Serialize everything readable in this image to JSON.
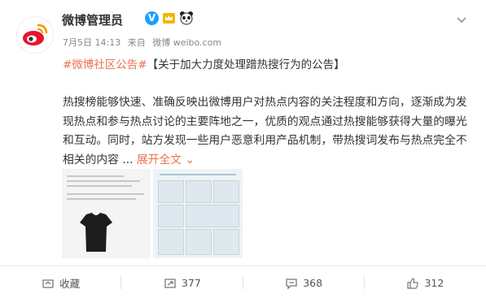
{
  "post": {
    "author": "微博管理员",
    "verified_label": "V",
    "time": "7月5日 14:13",
    "source_prefix": "来自",
    "source": "微博 weibo.com",
    "topic": "#微博社区公告#",
    "title": "【关于加大力度处理蹭热搜行为的公告】",
    "body_text": "热搜榜能够快速、准确反映出微博用户对热点内容的关注程度和方向，逐渐成为发现热点和参与热点讨论的主要阵地之一，优质的观点通过热搜能够获得大量的曝光和互动。同时，站方发现一些用户恶意利用产品机制，带热搜词发布与热点完全不相关的内容 ...",
    "expand_label": "展开全文",
    "icons": [
      "weibo-logo-icon",
      "crown-badge-icon",
      "panda-badge-icon",
      "chevron-down-icon",
      "forward-icon",
      "comment-icon",
      "like-icon"
    ]
  },
  "actions": {
    "forward_label": "收藏",
    "repost_count": "377",
    "comment_count": "368",
    "like_count": "312"
  },
  "colors": {
    "accent": "#eb7350",
    "verified": "#1aa0ff"
  }
}
